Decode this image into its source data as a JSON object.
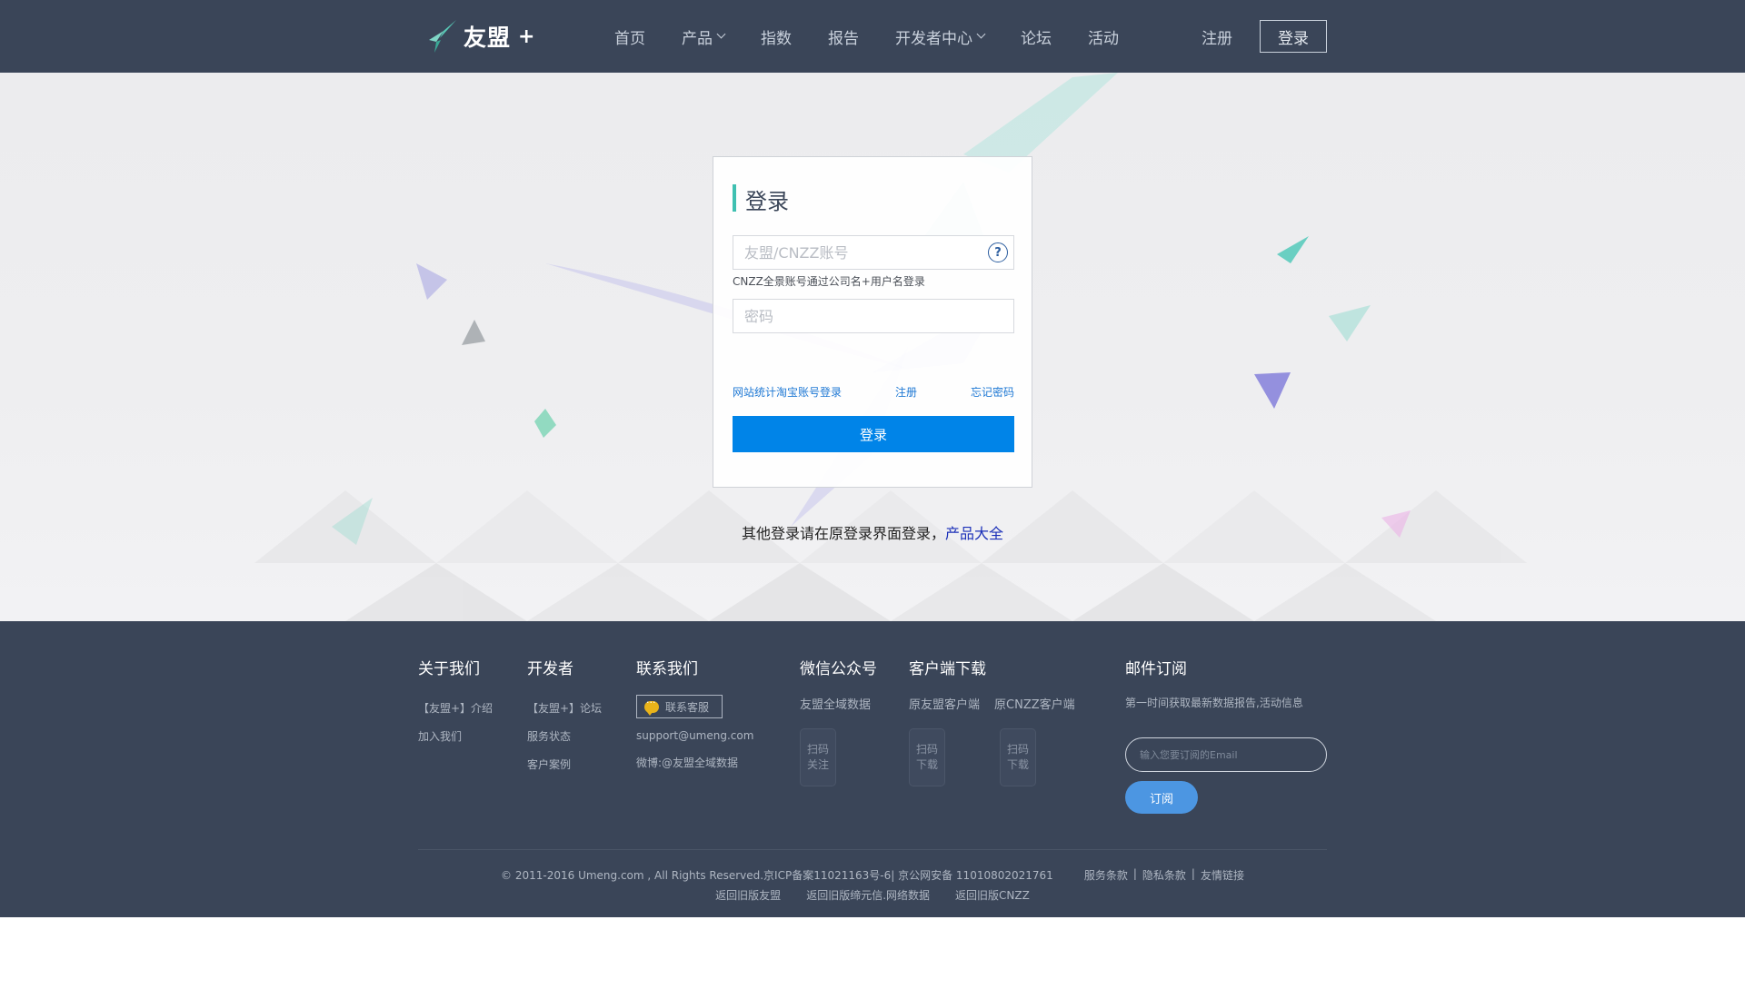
{
  "header": {
    "logo_text": "友盟",
    "logo_plus": "+",
    "nav": [
      {
        "label": "首页"
      },
      {
        "label": "产品"
      },
      {
        "label": "指数"
      },
      {
        "label": "报告"
      },
      {
        "label": "开发者中心"
      },
      {
        "label": "论坛"
      },
      {
        "label": "活动"
      }
    ],
    "register": "注册",
    "login": "登录"
  },
  "login_card": {
    "title": "登录",
    "account_placeholder": "友盟/CNZZ账号",
    "help_icon": "?",
    "account_hint": "CNZZ全景账号通过公司名+用户名登录",
    "password_placeholder": "密码",
    "links": {
      "taobao": "网站统计淘宝账号登录",
      "register": "注册",
      "forgot": "忘记密码"
    },
    "submit": "登录"
  },
  "other_login": {
    "text": "其他登录请在原登录界面登录，",
    "link": "产品大全"
  },
  "footer": {
    "about": {
      "title": "关于我们",
      "links": [
        "【友盟+】介绍",
        "加入我们"
      ]
    },
    "developer": {
      "title": "开发者",
      "links": [
        "【友盟+】论坛",
        "服务状态",
        "客户案例"
      ]
    },
    "contact": {
      "title": "联系我们",
      "button": "联系客服",
      "email": "support@umeng.com",
      "weibo": "微博:@友盟全域数据"
    },
    "wechat": {
      "title": "微信公众号",
      "name": "友盟全域数据",
      "qr_label": [
        "扫码",
        "关注"
      ]
    },
    "download": {
      "title": "客户端下载",
      "client1": "原友盟客户端",
      "client2": "原CNZZ客户端",
      "qr_label": [
        "扫码",
        "下载"
      ]
    },
    "subscribe": {
      "title": "邮件订阅",
      "desc": "第一时间获取最新数据报告,活动信息",
      "placeholder": "输入您要订阅的Email",
      "button": "订阅"
    },
    "copyright": "© 2011-2016 Umeng.com , All Rights Reserved.京ICP备案11021163号-6| 京公网安备 11010802021761",
    "legal_links": [
      "服务条款",
      "隐私条款",
      "友情链接"
    ],
    "legal_sep": "|",
    "old_links": [
      "返回旧版友盟",
      "返回旧版缔元信.网络数据",
      "返回旧版CNZZ"
    ]
  },
  "colors": {
    "header_bg": "#3a4558",
    "accent_teal": "#3fc0b1",
    "primary_button": "#0084e8",
    "link_blue": "#1e78d4",
    "subscribe_button": "#4c96e2"
  }
}
